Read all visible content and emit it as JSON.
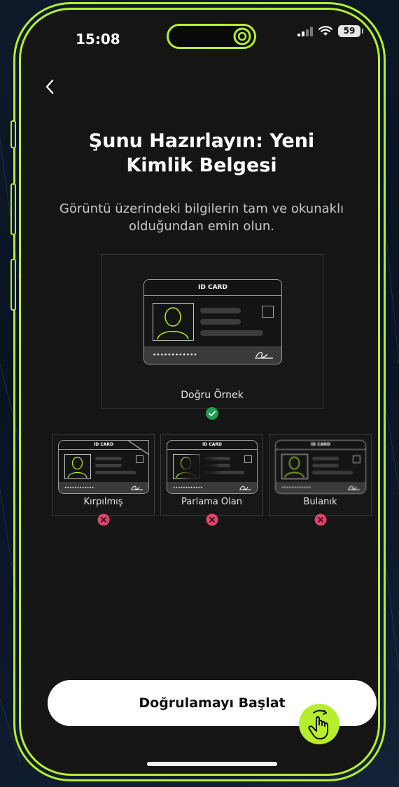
{
  "status_bar": {
    "time": "15:08",
    "battery": "59"
  },
  "page": {
    "title_line1": "Şunu Hazırlayın: Yeni",
    "title_line2": "Kimlik Belgesi",
    "subtitle_line1": "Görüntü üzerindeki bilgilerin tam ve okunaklı",
    "subtitle_line2": "olduğundan emin olun."
  },
  "examples": {
    "card_heading": "ID CARD",
    "correct": {
      "label": "Doğru Örnek",
      "status": "correct"
    },
    "incorrect": [
      {
        "label": "Kırpılmış",
        "status": "incorrect"
      },
      {
        "label": "Parlama Olan",
        "status": "incorrect"
      },
      {
        "label": "Bulanık",
        "status": "incorrect"
      }
    ]
  },
  "cta": {
    "label": "Doğrulamayı Başlat"
  },
  "colors": {
    "accent": "#b6ee2d",
    "success": "#1f9e50",
    "error": "#e0446d",
    "background": "#151515"
  },
  "icons": {
    "back": "chevron-left-icon",
    "signal": "signal-icon",
    "wifi": "wifi-icon",
    "battery": "battery-icon",
    "check": "check-circle-icon",
    "error": "x-circle-icon",
    "tap": "tap-gesture-icon"
  }
}
